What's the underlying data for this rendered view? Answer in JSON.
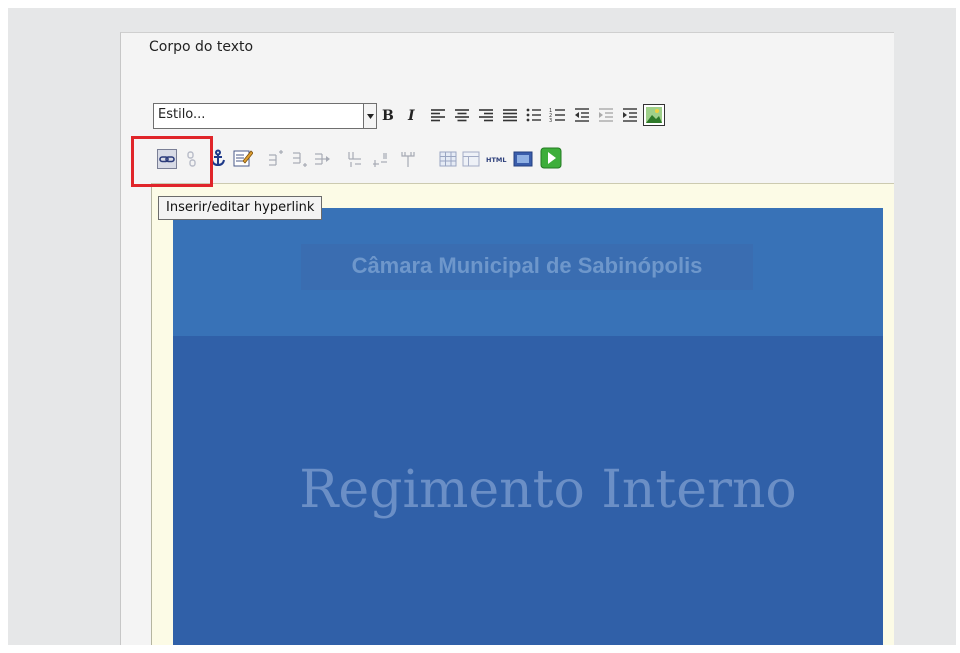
{
  "form": {
    "section_label": "Corpo do texto"
  },
  "toolbar": {
    "style_select": {
      "value": "Estilo..."
    },
    "row1_buttons": [
      {
        "name": "bold-button",
        "icon": "bold-icon"
      },
      {
        "name": "italic-button",
        "icon": "italic-icon"
      },
      {
        "name": "align-left-button",
        "icon": "align-left-icon"
      },
      {
        "name": "align-center-button",
        "icon": "align-center-icon"
      },
      {
        "name": "align-right-button",
        "icon": "align-right-icon"
      },
      {
        "name": "align-justify-button",
        "icon": "align-justify-icon"
      },
      {
        "name": "bullet-list-button",
        "icon": "bullet-list-icon"
      },
      {
        "name": "numbered-list-button",
        "icon": "numbered-list-icon"
      },
      {
        "name": "outdent-button",
        "icon": "outdent-icon"
      },
      {
        "name": "indent-button",
        "icon": "indent-icon"
      },
      {
        "name": "blockquote-button",
        "icon": "blockquote-icon"
      },
      {
        "name": "insert-image-button",
        "icon": "image-icon"
      }
    ],
    "row2_buttons": [
      {
        "name": "insert-link-button",
        "icon": "link-icon",
        "selected": true
      },
      {
        "name": "unlink-button",
        "icon": "unlink-icon",
        "disabled": true
      },
      {
        "name": "anchor-button",
        "icon": "anchor-icon"
      },
      {
        "name": "edit-button",
        "icon": "edit-icon"
      },
      {
        "name": "insert-row-before-button",
        "icon": "row-before-icon",
        "disabled": true
      },
      {
        "name": "insert-row-after-button",
        "icon": "row-after-icon",
        "disabled": true
      },
      {
        "name": "delete-row-button",
        "icon": "delete-row-icon",
        "disabled": true
      },
      {
        "name": "insert-col-before-button",
        "icon": "col-before-icon",
        "disabled": true
      },
      {
        "name": "insert-col-after-button",
        "icon": "col-after-icon",
        "disabled": true
      },
      {
        "name": "delete-col-button",
        "icon": "delete-col-icon",
        "disabled": true
      },
      {
        "name": "table-button",
        "icon": "table-icon"
      },
      {
        "name": "table-props-button",
        "icon": "table-props-icon"
      },
      {
        "name": "html-button",
        "icon": "html-icon",
        "label": "HTML"
      },
      {
        "name": "media-button",
        "icon": "media-icon"
      },
      {
        "name": "play-button",
        "icon": "play-icon"
      }
    ],
    "tooltip": "Inserir/editar hyperlink"
  },
  "document": {
    "header_title": "Câmara Municipal de Sabinópolis",
    "heading": "Regimento Interno"
  },
  "colors": {
    "highlight": "#e0252a",
    "doc_background": "#3060a8",
    "doc_header": "#3872b7",
    "editor_background": "#fcfbe6"
  }
}
